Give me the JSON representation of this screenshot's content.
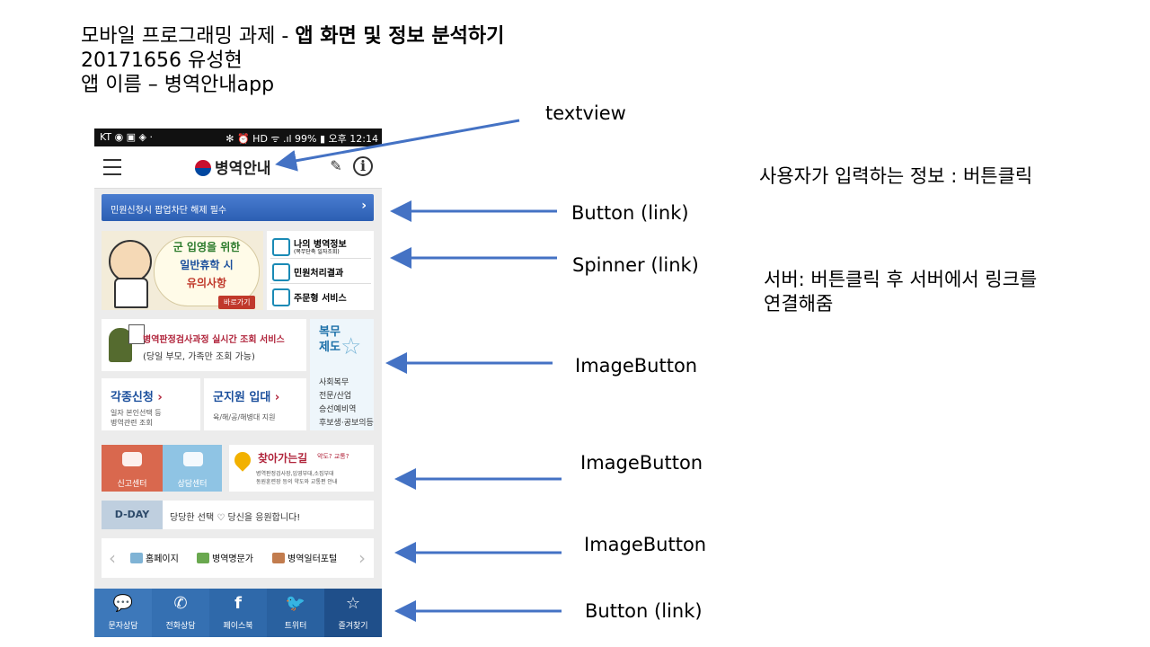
{
  "header": {
    "line1_prefix": "모바일 프로그래밍 과제 - ",
    "line1_bold": "앱 화면 및 정보 분석하기",
    "line2": "20171656 유성현",
    "line3": "앱 이름 – 병역안내app"
  },
  "notes": {
    "input": "사용자가 입력하는 정보 : 버튼클릭",
    "server_line1": "서버: 버튼클릭 후 서버에서 링크를",
    "server_line2": "연결해줌"
  },
  "annotations": {
    "textview": "textview",
    "button1": "Button (link)",
    "spinner": "Spinner (link)",
    "imagebutton1": "ImageButton",
    "imagebutton2": "ImageButton",
    "imagebutton3": "ImageButton",
    "button2": "Button (link)"
  },
  "phone": {
    "status_left": "KT ◉ ▣ ◈ ·",
    "status_right": "✻ ⏰ HD ᯤ .ıl 99% ▮ 오후 12:14",
    "app_title": "병역안내",
    "notice_button": "민원신청시 팝업차단 해제 필수",
    "notice_arrow": "›",
    "promo": {
      "line1": "군 입영을 위한",
      "line2": "일반휴학 시",
      "line3": "유의사항",
      "go": "바로가기"
    },
    "menu": [
      {
        "label": "나의 병역정보",
        "sub": "(복무단축 일자조회)"
      },
      {
        "label": "민원처리결과",
        "sub": ""
      },
      {
        "label": "주문형 서비스",
        "sub": ""
      }
    ],
    "inspection": {
      "title": "병역판정검사과정 실시간 조회 서비스",
      "sub": "(당일 부모, 가족만 조회 가능)"
    },
    "service": {
      "title_l1": "복무",
      "title_l2": "제도",
      "items": [
        "사회복무",
        "전문/산업",
        "승선예비역",
        "후보생·공보의등"
      ]
    },
    "apply": {
      "title": "각종신청",
      "sub1": "일자 본인선택 등",
      "sub2": "병역관련 조회"
    },
    "volunteer": {
      "title": "군지원 입대",
      "sub": "육/해/공/해병대 지원"
    },
    "report_center": "신고센터",
    "counsel_center": "상담센터",
    "directions": {
      "title": "찾아가는길",
      "tag": "약도? 교통?",
      "sub1": "병역판정검사장,입영부대,소집부대",
      "sub2": "동원훈련장 등의 약도와 교통편 안내"
    },
    "dday": {
      "tag": "D-DAY",
      "text": "당당한 선택 ♡ 당신을 응원합니다!"
    },
    "links": [
      "홈페이지",
      "병역명문가",
      "병역일터포털"
    ],
    "tabs": [
      {
        "icon": "💬",
        "label": "문자상담"
      },
      {
        "icon": "✆",
        "label": "전화상담"
      },
      {
        "icon": "f",
        "label": "페이스북"
      },
      {
        "icon": "🐦",
        "label": "트위터"
      },
      {
        "icon": "☆",
        "label": "즐겨찾기"
      }
    ]
  },
  "colors": {
    "arrow": "#4472c4",
    "app_blue": "#2d66a8",
    "accent_red": "#b0233a"
  }
}
